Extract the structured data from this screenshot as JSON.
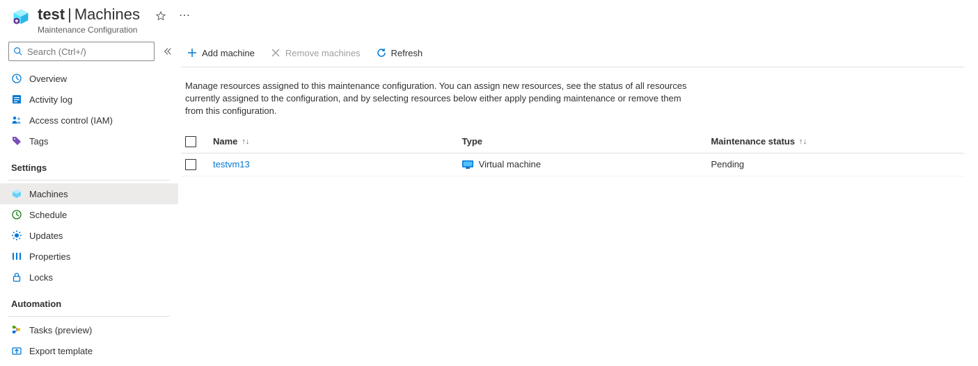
{
  "header": {
    "resource_name": "test",
    "section": "Machines",
    "subtitle": "Maintenance Configuration"
  },
  "search": {
    "placeholder": "Search (Ctrl+/)"
  },
  "sidebar": {
    "items_top": [
      {
        "label": "Overview"
      },
      {
        "label": "Activity log"
      },
      {
        "label": "Access control (IAM)"
      },
      {
        "label": "Tags"
      }
    ],
    "group_settings": "Settings",
    "items_settings": [
      {
        "label": "Machines"
      },
      {
        "label": "Schedule"
      },
      {
        "label": "Updates"
      },
      {
        "label": "Properties"
      },
      {
        "label": "Locks"
      }
    ],
    "group_automation": "Automation",
    "items_automation": [
      {
        "label": "Tasks (preview)"
      },
      {
        "label": "Export template"
      }
    ]
  },
  "toolbar": {
    "add": "Add machine",
    "remove": "Remove machines",
    "refresh": "Refresh"
  },
  "description": "Manage resources assigned to this maintenance configuration. You can assign new resources, see the status of all resources currently assigned to the configuration, and by selecting resources below either apply pending maintenance or remove them from this configuration.",
  "table": {
    "columns": {
      "name": "Name",
      "type": "Type",
      "status": "Maintenance status"
    },
    "rows": [
      {
        "name": "testvm13",
        "type": "Virtual machine",
        "status": "Pending"
      }
    ]
  }
}
